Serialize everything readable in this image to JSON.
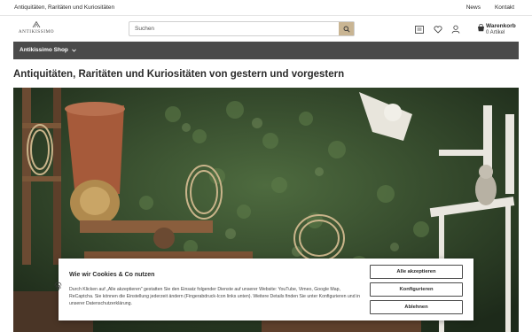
{
  "topbar": {
    "tagline": "Antiquitäten, Raritäten und Kuriositäten",
    "links": [
      "News",
      "Kontakt"
    ]
  },
  "header": {
    "logo_text": "ANTIKISSIMO",
    "search_placeholder": "Suchen",
    "icons": [
      "comparison-icon",
      "heart-icon",
      "user-icon",
      "cart-icon"
    ],
    "cart_label": "Warenkorb",
    "cart_count": "0 Artikel"
  },
  "nav": {
    "item": "Antikissimo Shop"
  },
  "main": {
    "heading": "Antiquitäten, Raritäten und Kuriositäten von gestern und vorgestern"
  },
  "cookie": {
    "title": "Wie wir Cookies & Co nutzen",
    "text": "Durch Klicken auf „Alle akzeptieren\" gestatten Sie den Einsatz folgender Dienste auf unserer Website: YouTube, Vimeo, Google Map, ReCaptcha. Sie können die Einstellung jederzeit ändern (Fingerabdruck-Icon links unten). Weitere Details finden Sie unter Konfigurieren und in unserer Datenschutzerklärung.",
    "accept_all": "Alle akzeptieren",
    "configure": "Konfigurieren",
    "decline": "Ablehnen"
  },
  "colors": {
    "accent": "#c9b593",
    "nav_bg": "#4a4a4a"
  }
}
